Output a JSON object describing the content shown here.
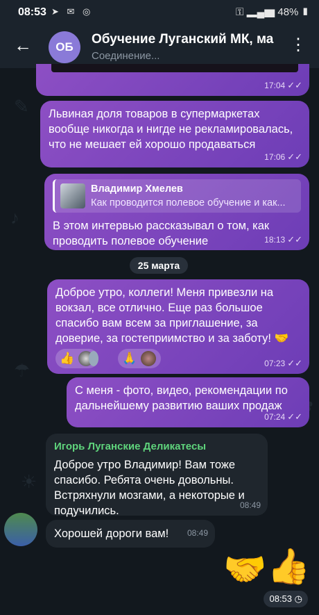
{
  "status_bar": {
    "time": "08:53",
    "battery": "48%"
  },
  "header": {
    "avatar_initials": "ОБ",
    "title": "Обучение Луганский МК, ма",
    "subtitle": "Соединение..."
  },
  "messages": [
    {
      "id": "m0",
      "time": "17:04"
    },
    {
      "id": "m1",
      "text": "Львиная доля товаров в супермаркетах вообще никогда и нигде не рекламировалась, что не мешает ей хорошо продаваться",
      "time": "17:06"
    },
    {
      "id": "m2",
      "reply_name": "Владимир Хмелев",
      "reply_text": "Как проводится полевое обучение и как...",
      "text": "В этом интервью рассказывал о том, как проводить полевое обучение",
      "time": "18:13"
    },
    {
      "id": "m3",
      "text": "Доброе утро, коллеги! Меня привезли на вокзал, все отлично. Еще раз большое спасибо вам всем за приглашение, за доверие, за гостеприимство и за заботу! 🤝",
      "time": "07:23",
      "reactions": [
        "👍",
        "🙏"
      ]
    },
    {
      "id": "m4",
      "text": "С меня - фото, видео, рекомендации по дальнейшему развитию ваших продаж",
      "time": "07:24"
    },
    {
      "id": "m5",
      "sender": "Игорь Луганские Деликатесы",
      "text": "Доброе утро Владимир! Вам тоже спасибо. Ребята очень довольны. Встряхнули мозгами, а некоторые и подучились.",
      "time": "08:49"
    },
    {
      "id": "m6",
      "text": "Хорошей дороги вам!",
      "time": "08:49"
    }
  ],
  "date_separator": "25 марта",
  "last_message": {
    "emojis": [
      "🤝",
      "👍"
    ],
    "time": "08:53"
  },
  "colors": {
    "outgoing_bubble": "#7a45bd",
    "incoming_bubble": "#1f262d",
    "sender_name": "#5fd47c"
  }
}
